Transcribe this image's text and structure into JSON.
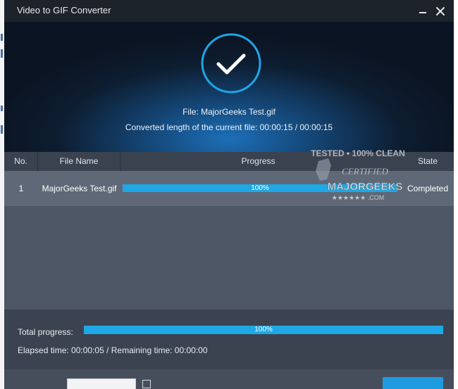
{
  "window": {
    "title": "Video to GIF Converter",
    "minimize_glyph": "—",
    "close_glyph": "×"
  },
  "status": {
    "icon": "checkmark-circle-icon",
    "file_line": "File: MajorGeeks Test.gif",
    "length_line": "Converted length of the current file: 00:00:15 / 00:00:15"
  },
  "table": {
    "headers": {
      "no": "No.",
      "file_name": "File Name",
      "progress": "Progress",
      "state": "State"
    },
    "rows": [
      {
        "no": "1",
        "file_name": "MajorGeeks Test.gif",
        "progress_label": "100%",
        "progress_value": 1.0,
        "state": "Completed"
      }
    ]
  },
  "watermark": {
    "text": "TESTED • 100% CLEAN CERTIFIED MAJORGEEKS .COM"
  },
  "footer": {
    "total_label": "Total progress:",
    "total_progress_label": "100%",
    "total_progress_value": 1.0,
    "elapsed_line": "Elapsed time: 00:00:05 / Remaining time: 00:00:00"
  },
  "colors": {
    "accent": "#1ea9e6",
    "titlebar": "#1c232b",
    "panel": "#4a5568"
  }
}
